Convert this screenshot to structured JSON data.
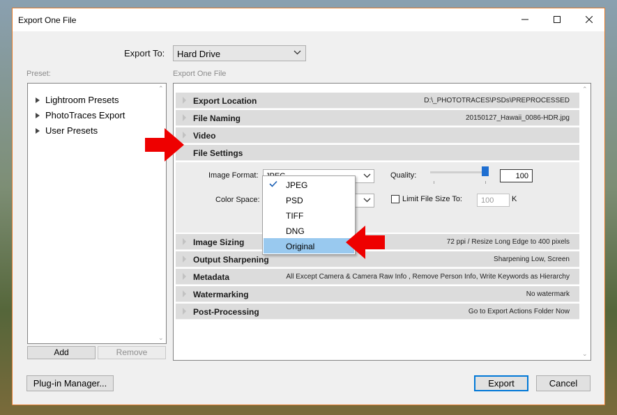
{
  "window": {
    "title": "Export One File"
  },
  "export_to": {
    "label": "Export To:",
    "value": "Hard Drive"
  },
  "preset": {
    "label": "Preset:",
    "items": [
      {
        "label": "Lightroom Presets"
      },
      {
        "label": "PhotoTraces Export"
      },
      {
        "label": "User Presets"
      }
    ],
    "add_label": "Add",
    "remove_label": "Remove"
  },
  "main": {
    "label": "Export One File"
  },
  "sections": {
    "export_location": {
      "name": "Export Location",
      "value": "D:\\_PHOTOTRACES\\PSDs\\PREPROCESSED"
    },
    "file_naming": {
      "name": "File Naming",
      "value": "20150127_Hawaii_0086-HDR.jpg"
    },
    "video": {
      "name": "Video"
    },
    "file_settings": {
      "name": "File Settings"
    },
    "image_sizing": {
      "name": "Image Sizing",
      "value": "72 ppi / Resize Long Edge to 400 pixels"
    },
    "output_sharpening": {
      "name": "Output Sharpening",
      "value": "Sharpening Low, Screen"
    },
    "metadata": {
      "name": "Metadata",
      "value": "All Except Camera & Camera Raw Info , Remove Person Info, Write Keywords as Hierarchy"
    },
    "watermarking": {
      "name": "Watermarking",
      "value": "No watermark"
    },
    "post_processing": {
      "name": "Post-Processing",
      "value": "Go to Export Actions Folder Now"
    }
  },
  "file_settings": {
    "image_format_label": "Image Format:",
    "image_format_value": "JPEG",
    "color_space_label": "Color Space:",
    "quality_label": "Quality:",
    "quality_value": "100",
    "quality_fraction": 1.0,
    "limit_label": "Limit File Size To:",
    "limit_value": "100",
    "limit_unit": "K"
  },
  "format_dropdown": {
    "options": [
      {
        "label": "JPEG",
        "checked": true
      },
      {
        "label": "PSD"
      },
      {
        "label": "TIFF"
      },
      {
        "label": "DNG"
      },
      {
        "label": "Original",
        "highlighted": true
      }
    ]
  },
  "footer": {
    "plugin_manager_label": "Plug-in Manager...",
    "export_label": "Export",
    "cancel_label": "Cancel"
  },
  "colors": {
    "accent_arrow": "#ee0000",
    "highlight": "#99c9ef",
    "window_border": "#e07a2a"
  }
}
